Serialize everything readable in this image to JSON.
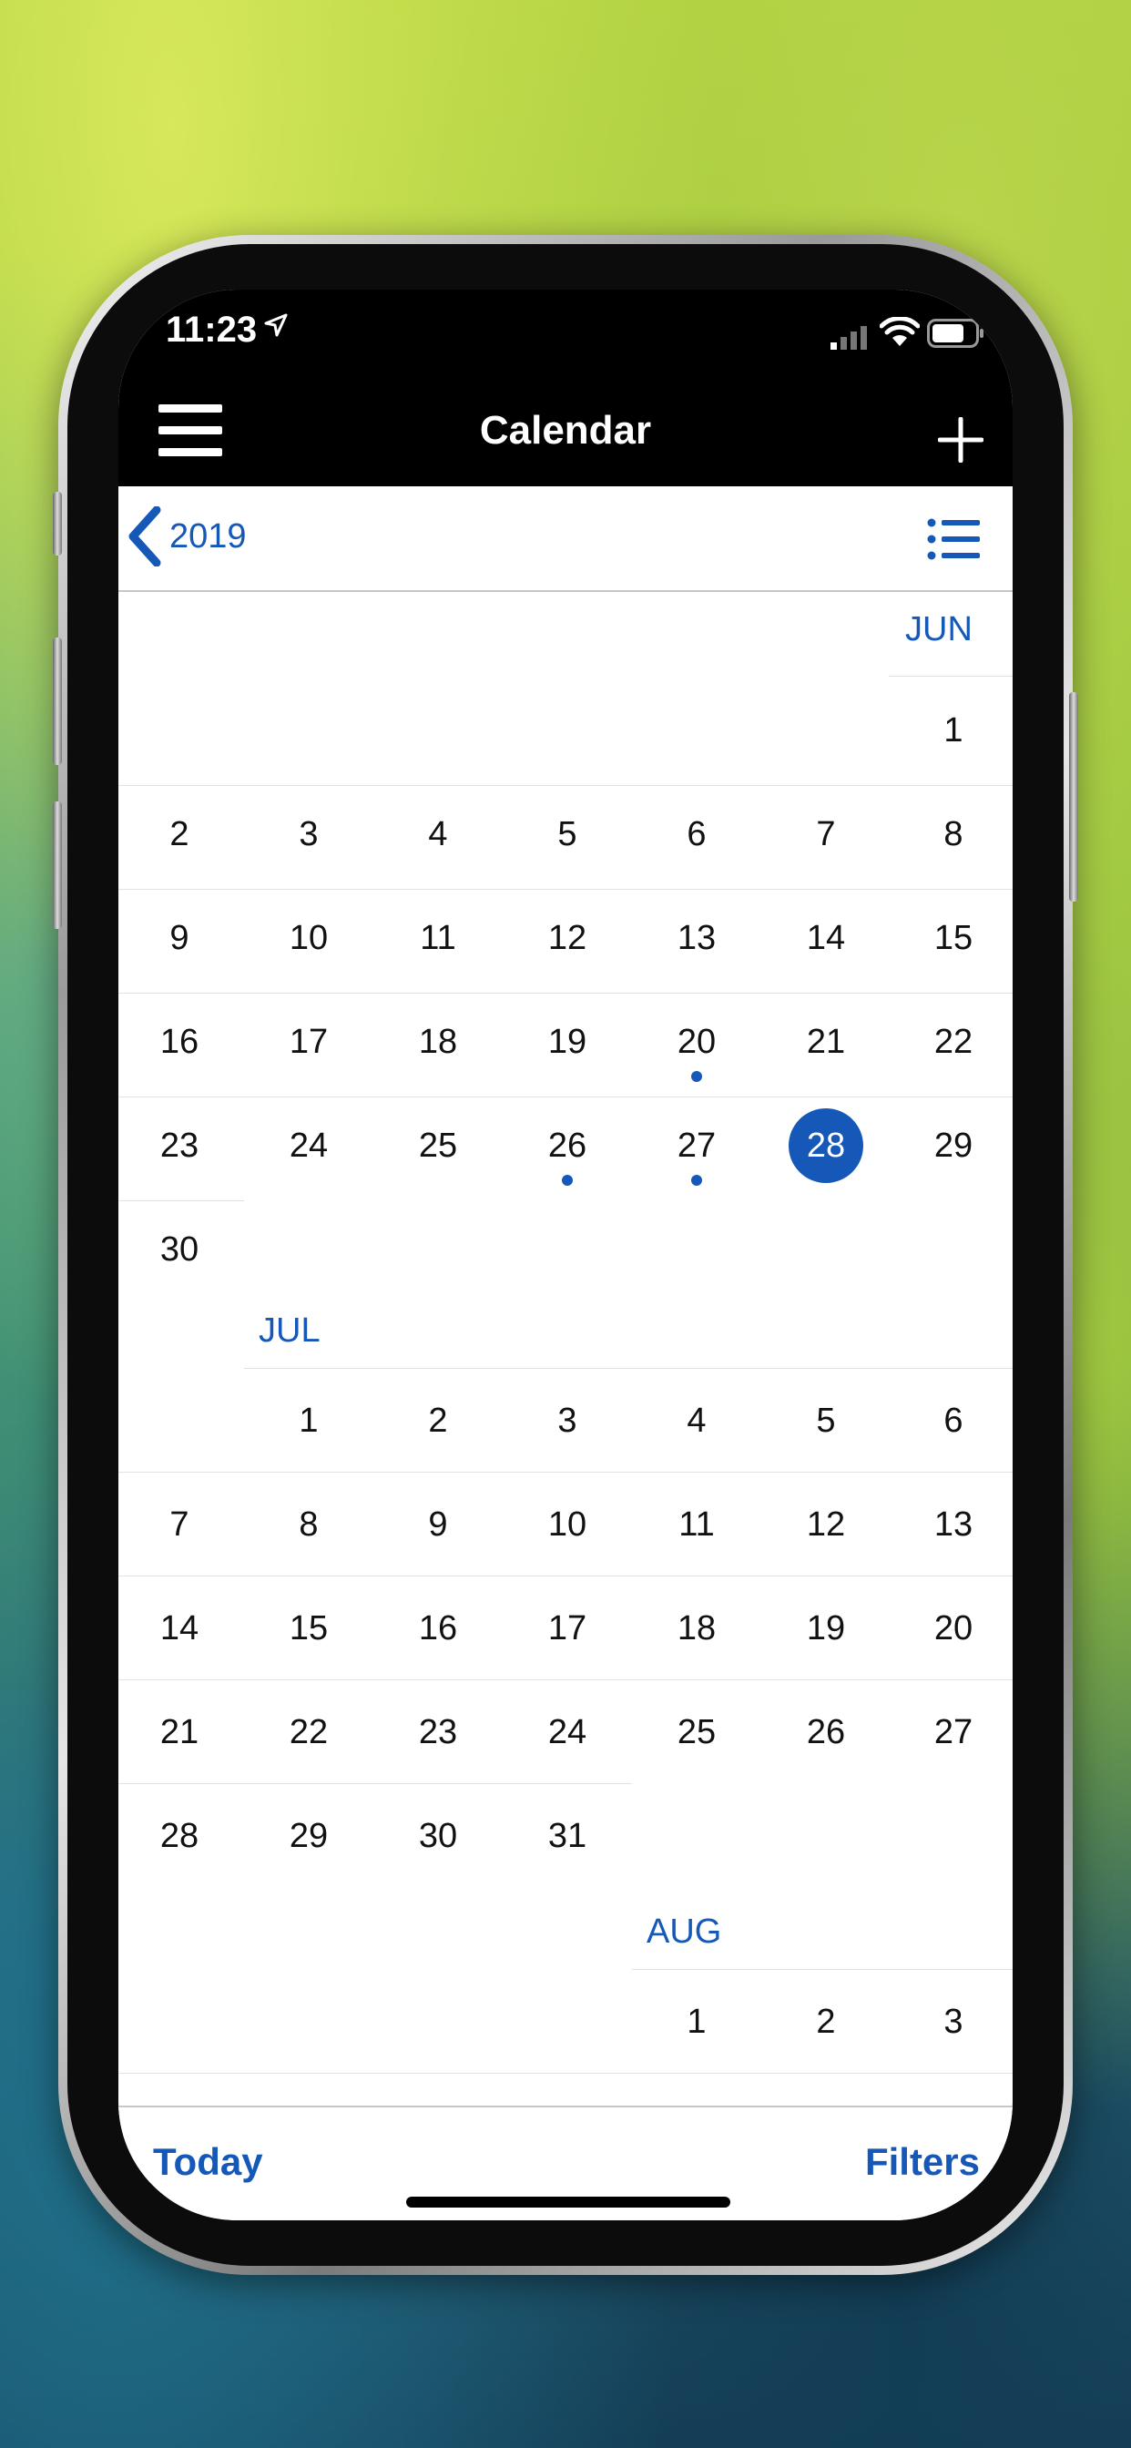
{
  "status_bar": {
    "time": "11:23"
  },
  "nav": {
    "title": "Calendar"
  },
  "year_nav": {
    "year": "2019"
  },
  "calendar": {
    "jun": {
      "label": "JUN",
      "row1": [
        "1"
      ],
      "row2": [
        "2",
        "3",
        "4",
        "5",
        "6",
        "7",
        "8"
      ],
      "row3": [
        "9",
        "10",
        "11",
        "12",
        "13",
        "14",
        "15"
      ],
      "row4": [
        "16",
        "17",
        "18",
        "19",
        "20",
        "21",
        "22"
      ],
      "row5": [
        "23",
        "24",
        "25",
        "26",
        "27",
        "28",
        "29"
      ],
      "row6": [
        "30"
      ]
    },
    "jul": {
      "label": "JUL",
      "row1": [
        "1",
        "2",
        "3",
        "4",
        "5",
        "6"
      ],
      "row2": [
        "7",
        "8",
        "9",
        "10",
        "11",
        "12",
        "13"
      ],
      "row3": [
        "14",
        "15",
        "16",
        "17",
        "18",
        "19",
        "20"
      ],
      "row4": [
        "21",
        "22",
        "23",
        "24",
        "25",
        "26",
        "27"
      ],
      "row5": [
        "28",
        "29",
        "30",
        "31"
      ]
    },
    "aug": {
      "label": "AUG",
      "row1": [
        "1",
        "2",
        "3"
      ]
    },
    "selected_day": "28",
    "event_days_june": [
      "20",
      "26",
      "27"
    ],
    "accent_color": "#1558b8"
  },
  "toolbar": {
    "today_label": "Today",
    "filters_label": "Filters"
  }
}
